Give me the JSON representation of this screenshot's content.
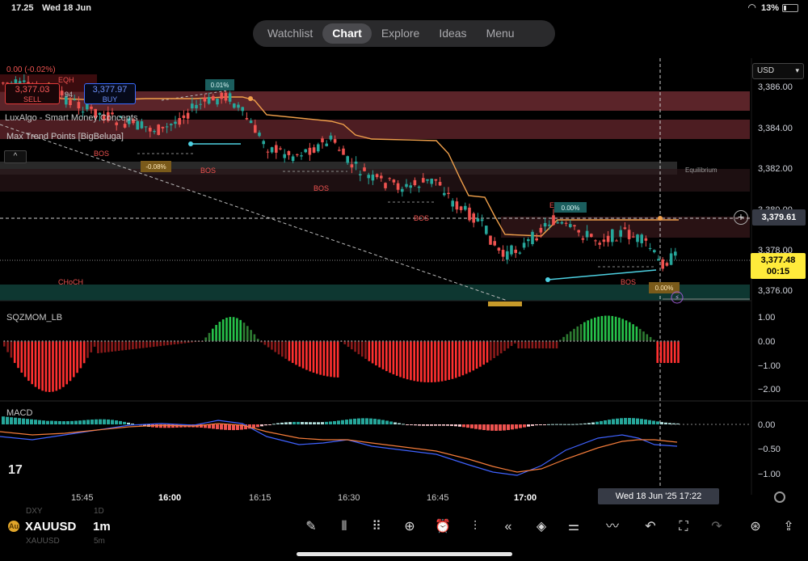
{
  "status_bar": {
    "time": "17.25",
    "date": "Wed 18 Jun",
    "battery": "13%"
  },
  "nav": {
    "tabs": [
      "Watchlist",
      "Chart",
      "Explore",
      "Ideas",
      "Menu"
    ],
    "active": "Chart"
  },
  "currency": "USD",
  "trade": {
    "sell_price": "3,377.03",
    "sell_label": "SELL",
    "buy_price": "3,377.97",
    "buy_label": "BUY",
    "spread": "94"
  },
  "overlay_text": {
    "change": "0.00 (-0.02%)",
    "eqh": "EQH"
  },
  "indicators": {
    "ind1": "LuxAlgo - Smart Money Concepts",
    "ind2": "Max Trend Points [BigBeluga]",
    "collapse": "^"
  },
  "annotations": {
    "bos": "BOS",
    "choch": "CHoCH",
    "equilibrium": "Equilibrium",
    "eq_short": "EQ",
    "pct_a": "0.01%",
    "pct_b": "-0.08%",
    "pct_c": "0.00%",
    "pct_d": "0.00%"
  },
  "price_axis": {
    "ticks": [
      "3,386.00",
      "3,384.00",
      "3,382.00",
      "3,380.00",
      "3,378.00",
      "3,376.00"
    ]
  },
  "crosshair_price": "3,379.61",
  "last_price": {
    "price": "3,377.48",
    "countdown": "00:15"
  },
  "panes": {
    "sqzmom": {
      "label": "SQZMOM_LB",
      "ticks": [
        "1.00",
        "0.00",
        "−1.00",
        "−2.00"
      ]
    },
    "macd": {
      "label": "MACD",
      "ticks": [
        "0.00",
        "−0.50",
        "−1.00"
      ]
    }
  },
  "time_axis": {
    "labels": [
      "15:45",
      "16:00",
      "16:15",
      "16:30",
      "16:45",
      "17:00"
    ],
    "bold": [
      "16:00",
      "17:00"
    ]
  },
  "crosshair_date": "Wed 18 Jun '25   17:22",
  "bottom": {
    "symbol": "XAUUSD",
    "interval": "1m",
    "ghost_symbol_1": "DXY",
    "ghost_interval_1": "1D",
    "ghost_symbol_2": "XAUUSD",
    "ghost_interval_2": "5m"
  },
  "colors": {
    "up": "#26a69a",
    "down": "#ef5350",
    "last_price": "#ffeb3b",
    "trail": "#f0a04b",
    "accent_red": "#e03a3a",
    "accent_blue": "#3a6bff"
  }
}
